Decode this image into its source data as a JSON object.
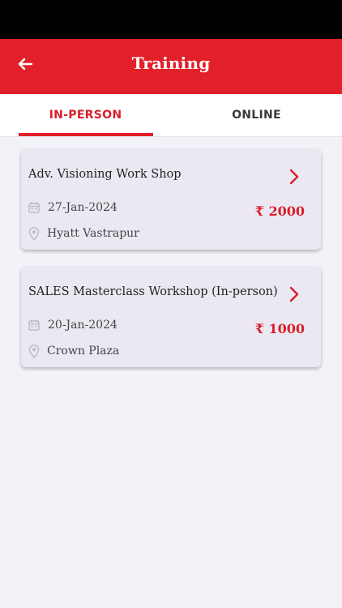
{
  "app_bar": {
    "title": "Training",
    "back_icon": "arrow-left-icon"
  },
  "tabs": [
    {
      "label": "IN-PERSON",
      "selected": true
    },
    {
      "label": "ONLINE",
      "selected": false
    }
  ],
  "colors": {
    "accent": "#e2202a",
    "background": "#f3f2f8",
    "card": "#ece8f2"
  },
  "trainings": [
    {
      "title": "Adv. Visioning Work Shop",
      "date": "27-Jan-2024",
      "venue": "Hyatt Vastrapur",
      "price": "₹ 2000"
    },
    {
      "title": "SALES Masterclass Workshop (In-person)",
      "date": "20-Jan-2024",
      "venue": "Crown Plaza",
      "price": "₹ 1000"
    }
  ]
}
